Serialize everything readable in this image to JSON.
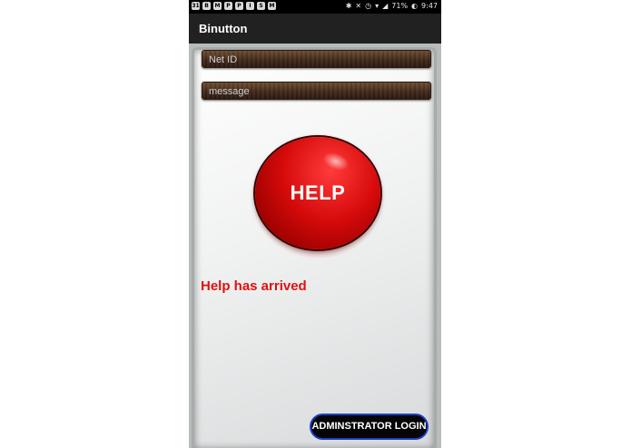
{
  "status_bar": {
    "left_icons": [
      "31",
      "B",
      "M",
      "P",
      "P",
      "I",
      "S",
      "M"
    ],
    "battery_percent": "71%",
    "time": "9:47"
  },
  "app_bar": {
    "title": "Binutton"
  },
  "form": {
    "net_id_placeholder": "Net ID",
    "message_placeholder": "message"
  },
  "help_button": {
    "label": "HELP"
  },
  "status_message": "Help has arrived",
  "admin_button": {
    "label": "ADMINSTRATOR LOGIN"
  },
  "colors": {
    "app_bar": "#212121",
    "help_red": "#d60a0a",
    "status_text": "#e01010",
    "admin_border": "#1e3ec8"
  }
}
